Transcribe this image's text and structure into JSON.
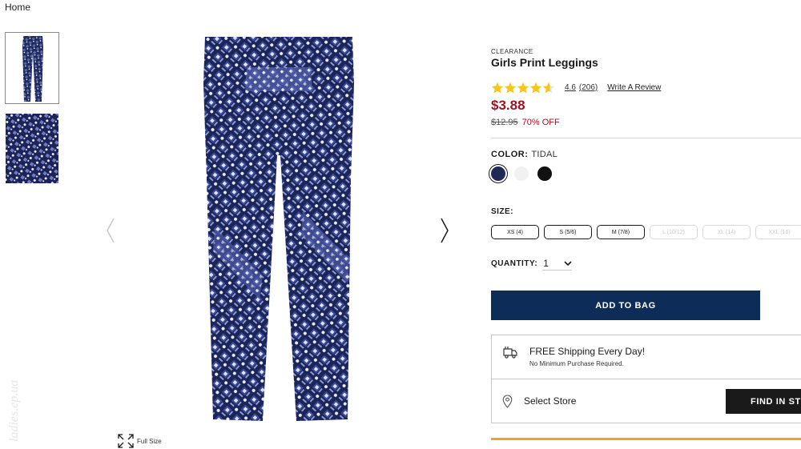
{
  "breadcrumb": {
    "home": "Home"
  },
  "gallery": {
    "thumbnails": [
      "leggings-full-view",
      "fabric-print-closeup"
    ],
    "full_size_label": "Full Size"
  },
  "watermark": {
    "text": "ladies.ep.ua"
  },
  "product": {
    "badge": "CLEARANCE",
    "title": "Girls Print Leggings",
    "rating": {
      "stars": 4.6,
      "value": "4.6",
      "count": "(206)",
      "write_review": "Write A Review"
    },
    "price": "$3.88",
    "was_price": "$12.95",
    "discount": "70% OFF",
    "color": {
      "label": "COLOR:",
      "selected": "TIDAL",
      "swatches": [
        {
          "name": "Tidal",
          "hex": "#1d2a55"
        },
        {
          "name": "White",
          "hex": "#f1f1f1"
        },
        {
          "name": "Black",
          "hex": "#111111"
        }
      ]
    },
    "size": {
      "label": "SIZE:",
      "options": [
        {
          "label": "XS (4)",
          "available": true
        },
        {
          "label": "S (5/6)",
          "available": true
        },
        {
          "label": "M (7/8)",
          "available": true
        },
        {
          "label": "L (10/12)",
          "available": false
        },
        {
          "label": "XL (14)",
          "available": false
        },
        {
          "label": "XXL (16)",
          "available": false
        }
      ]
    },
    "quantity": {
      "label": "QUANTITY:",
      "value": "1"
    },
    "add_to_bag": "ADD TO BAG",
    "shipping": {
      "title": "FREE Shipping Every Day!",
      "subtitle": "No Minimum Purchase Required."
    },
    "store": {
      "label": "Select Store",
      "button": "FIND IN STORE"
    }
  },
  "colors": {
    "accent_navy": "#0d2c58",
    "price_red": "#a3121f",
    "star_gold": "#f5c518",
    "bottom_bar": "#f0a229"
  }
}
